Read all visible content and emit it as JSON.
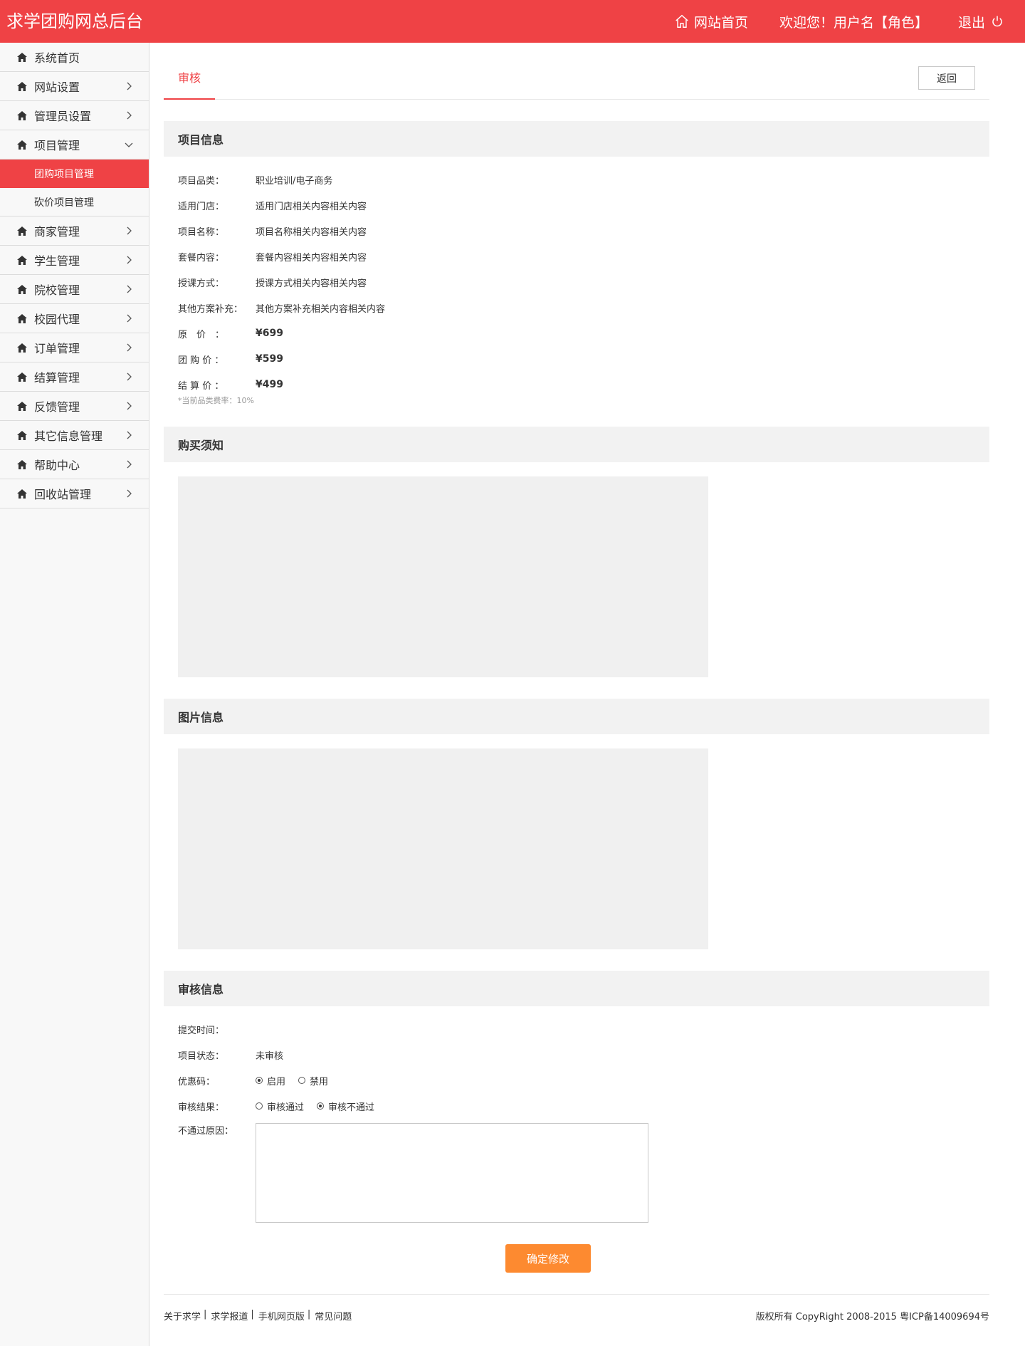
{
  "header": {
    "title": "求学团购网总后台",
    "home_link": "网站首页",
    "welcome": "欢迎您！用户名【角色】",
    "logout": "退出",
    "home_icon": "house-outline-icon",
    "logout_icon": "power-icon",
    "bg_color": "#ef4245"
  },
  "sidebar": {
    "items": [
      {
        "label": "系统首页"
      },
      {
        "label": "网站设置"
      },
      {
        "label": "管理员设置"
      },
      {
        "label": "项目管理",
        "expanded": true,
        "children": [
          {
            "label": "团购项目管理",
            "active": true
          },
          {
            "label": "砍价项目管理"
          }
        ]
      },
      {
        "label": "商家管理"
      },
      {
        "label": "学生管理"
      },
      {
        "label": "院校管理"
      },
      {
        "label": "校园代理"
      },
      {
        "label": "订单管理"
      },
      {
        "label": "结算管理"
      },
      {
        "label": "反馈管理"
      },
      {
        "label": "其它信息管理"
      },
      {
        "label": "帮助中心"
      },
      {
        "label": "回收站管理"
      }
    ]
  },
  "tabs": {
    "active": "审核",
    "back_button": "返回"
  },
  "project_info": {
    "title": "项目信息",
    "rows": [
      {
        "label": "项目品类：",
        "value": "职业培训/电子商务"
      },
      {
        "label": "适用门店：",
        "value": "适用门店相关内容相关内容"
      },
      {
        "label": "项目名称：",
        "value": "项目名称相关内容相关内容"
      },
      {
        "label": "套餐内容：",
        "value": "套餐内容相关内容相关内容"
      },
      {
        "label": "授课方式：",
        "value": "授课方式相关内容相关内容"
      },
      {
        "label": "其他方案补充：",
        "value": "其他方案补充相关内容相关内容"
      }
    ],
    "prices": [
      {
        "label": "原　价　：",
        "value": "¥699"
      },
      {
        "label": "团 购 价 ：",
        "value": "¥599"
      },
      {
        "label": "结 算 价 ：",
        "value": "¥499"
      }
    ],
    "note": "*当前品类费率：10%"
  },
  "purchase_notice": {
    "title": "购买须知"
  },
  "image_info": {
    "title": "图片信息"
  },
  "audit_info": {
    "title": "审核信息",
    "submit_time_label": "提交时间：",
    "submit_time_value": "",
    "status_label": "项目状态：",
    "status_value": "未审核",
    "coupon_label": "优惠码：",
    "coupon_options": [
      "启用",
      "禁用"
    ],
    "coupon_selected": "启用",
    "result_label": "审核结果：",
    "result_options": [
      "审核通过",
      "审核不通过"
    ],
    "result_selected": "审核不通过",
    "reason_label": "不通过原因：",
    "reason_value": "",
    "submit_button": "确定修改",
    "submit_color": "#fd8a30"
  },
  "footer": {
    "links": [
      "关于求学",
      "求学报道",
      "手机网页版",
      "常见问题"
    ],
    "separator": "|",
    "copyright": "版权所有 CopyRight 2008-2015 粤ICP备14009694号"
  }
}
